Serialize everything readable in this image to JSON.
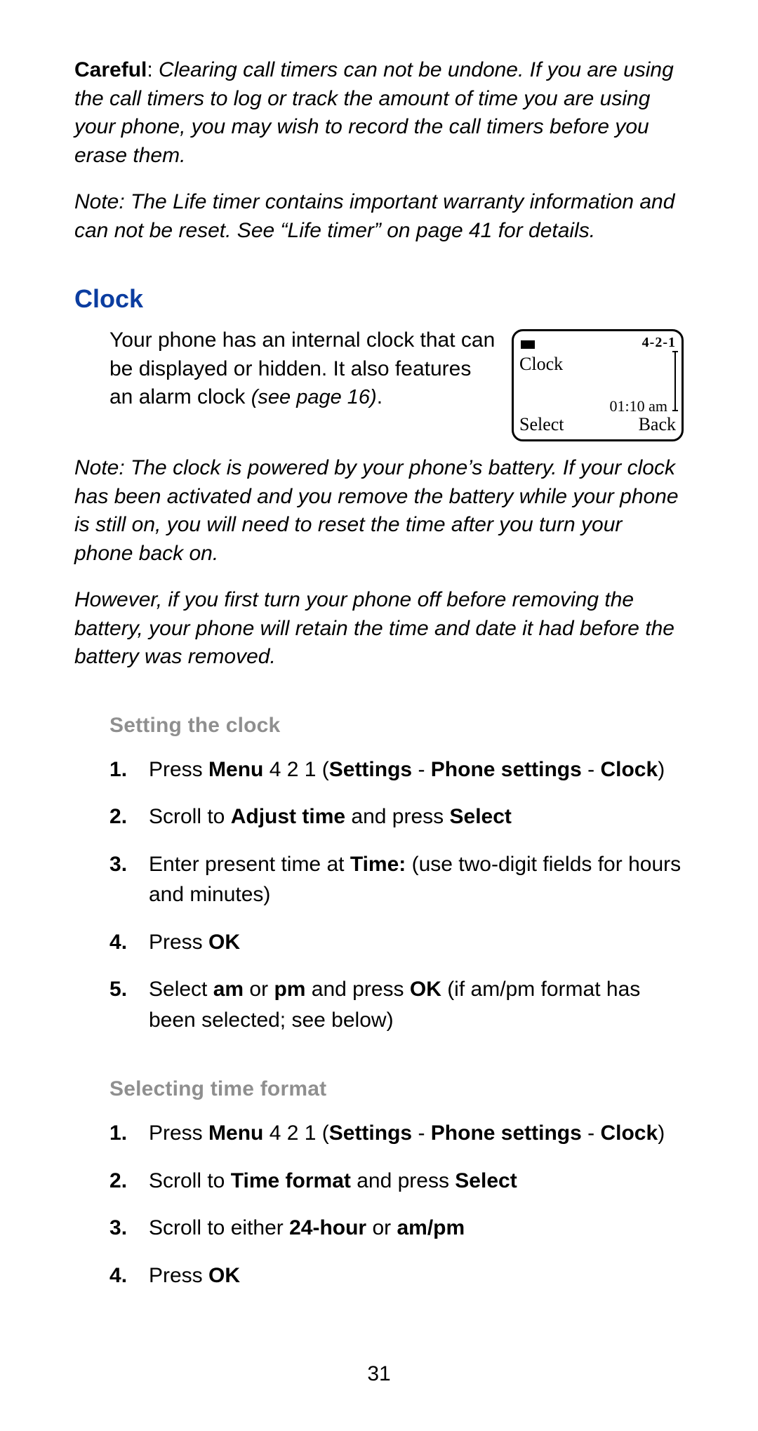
{
  "careful": {
    "label": "Careful",
    "sep": ": ",
    "text": "Clearing call timers can not be undone. If you are using the call timers to log or track the amount of time you are using your phone, you may wish to record the call timers before you erase them."
  },
  "note_life": "Note: The Life timer contains important warranty information and can not be reset. See “Life timer” on page 41 for details.",
  "clock": {
    "heading": "Clock",
    "intro_line": "Your phone has an internal clock that can be displayed or hidden. It also features an alarm clock ",
    "see_page": "(see page 16)",
    "period": ".",
    "note1": "Note: The clock is powered by your phone’s battery. If your clock has been activated and you remove the battery while your phone is still on, you will need to reset the time after you turn your phone back on.",
    "note2": "However, if you first turn your phone off before removing the battery, your phone will retain the time and date it had before the battery was removed."
  },
  "phone_screen": {
    "title": "Clock",
    "menu_code": "4-2-1",
    "time": "01:10 am",
    "left_softkey": "Select",
    "right_softkey": "Back"
  },
  "setting_clock": {
    "heading": "Setting the clock",
    "steps": [
      {
        "pre": "Press ",
        "b1": "Menu",
        "mid1": " 4 2 1 (",
        "b2": "Settings",
        "mid2": " - ",
        "b3": "Phone settings",
        "mid3": " - ",
        "b4": "Clock",
        "post": ")"
      },
      {
        "pre": "Scroll to ",
        "b1": "Adjust time",
        "mid1": " and press ",
        "b2": "Select",
        "mid2": "",
        "b3": "",
        "mid3": "",
        "b4": "",
        "post": ""
      },
      {
        "pre": "Enter present time at ",
        "b1": "Time:",
        "mid1": " (use two-digit fields for hours and minutes)",
        "b2": "",
        "mid2": "",
        "b3": "",
        "mid3": "",
        "b4": "",
        "post": ""
      },
      {
        "pre": "Press ",
        "b1": "OK",
        "mid1": "",
        "b2": "",
        "mid2": "",
        "b3": "",
        "mid3": "",
        "b4": "",
        "post": ""
      },
      {
        "pre": "Select ",
        "b1": "am",
        "mid1": " or ",
        "b2": "pm",
        "mid2": " and press ",
        "b3": "OK",
        "mid3": " (if am/pm format has been selected; see below)",
        "b4": "",
        "post": ""
      }
    ]
  },
  "time_format": {
    "heading": "Selecting time format",
    "steps": [
      {
        "pre": "Press ",
        "b1": "Menu",
        "mid1": " 4 2 1 (",
        "b2": "Settings",
        "mid2": " - ",
        "b3": "Phone settings",
        "mid3": " - ",
        "b4": "Clock",
        "post": ")"
      },
      {
        "pre": "Scroll to ",
        "b1": "Time format",
        "mid1": " and press ",
        "b2": "Select",
        "mid2": "",
        "b3": "",
        "mid3": "",
        "b4": "",
        "post": ""
      },
      {
        "pre": "Scroll to either ",
        "b1": "24-hour",
        "mid1": " or ",
        "b2": "am/pm",
        "mid2": "",
        "b3": "",
        "mid3": "",
        "b4": "",
        "post": ""
      },
      {
        "pre": "Press ",
        "b1": "OK",
        "mid1": "",
        "b2": "",
        "mid2": "",
        "b3": "",
        "mid3": "",
        "b4": "",
        "post": ""
      }
    ]
  },
  "page_number": "31"
}
